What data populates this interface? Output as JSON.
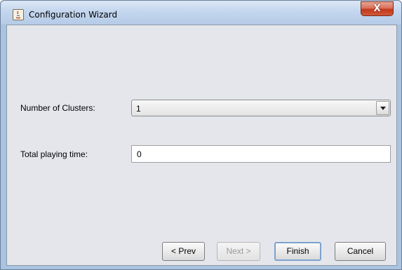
{
  "window": {
    "title": "Configuration Wizard",
    "close_label": "X"
  },
  "form": {
    "clusters_label": "Number of Clusters:",
    "clusters_value": "1",
    "playing_time_label": "Total playing time:",
    "playing_time_value": "0"
  },
  "buttons": {
    "prev": "< Prev",
    "next": "Next >",
    "finish": "Finish",
    "cancel": "Cancel"
  },
  "colors": {
    "titlebar": "#c4d6ee",
    "content_bg": "#e4e6eb",
    "close_red": "#c2391c"
  }
}
